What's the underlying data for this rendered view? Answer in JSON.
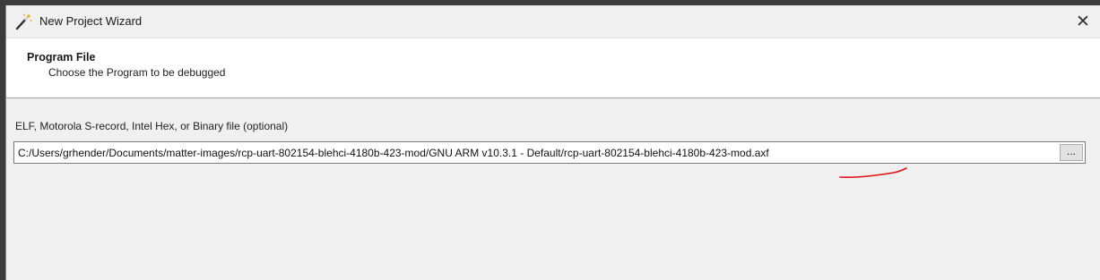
{
  "window": {
    "title": "New Project Wizard",
    "close_glyph": "✕"
  },
  "header": {
    "title": "Program File",
    "subtitle": "Choose the Program to be debugged"
  },
  "program_file": {
    "label": "ELF, Motorola S-record, Intel Hex, or Binary file (optional)",
    "value": "C:/Users/grhender/Documents/matter-images/rcp-uart-802154-blehci-4180b-423-mod/GNU ARM v10.3.1 - Default/rcp-uart-802154-blehci-4180b-423-mod.axf",
    "browse_label": "..."
  },
  "icons": {
    "title": "wizard-wand-icon",
    "close": "close-icon"
  },
  "colors": {
    "annotation": "#e01010",
    "frame": "#3c3c3c",
    "header_bg": "#ffffff",
    "dialog_bg": "#f0f0f0"
  }
}
